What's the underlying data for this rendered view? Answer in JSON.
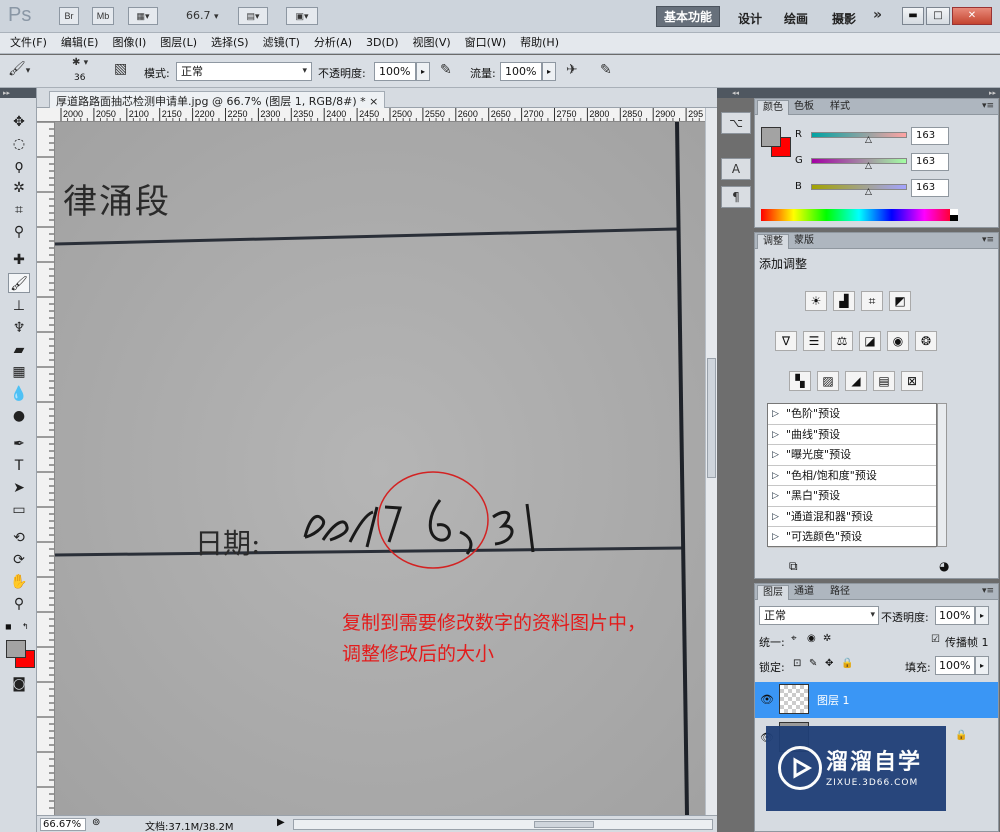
{
  "app": {
    "logo_text": "Ps",
    "bridge_label": "Br",
    "minibridge_label": "Mb",
    "zoom": "66.7"
  },
  "workspaces": {
    "essentials": "基本功能",
    "design": "设计",
    "painting": "绘画",
    "photography": "摄影",
    "more": "»"
  },
  "menu": [
    "文件(F)",
    "编辑(E)",
    "图像(I)",
    "图层(L)",
    "选择(S)",
    "滤镜(T)",
    "分析(A)",
    "3D(D)",
    "视图(V)",
    "窗口(W)",
    "帮助(H)"
  ],
  "options": {
    "brush_size": "36",
    "mode_label": "模式:",
    "mode_value": "正常",
    "opacity_label": "不透明度:",
    "opacity_value": "100%",
    "flow_label": "流量:",
    "flow_value": "100%"
  },
  "document": {
    "tab_title": "厚道路路面抽芯检测申请单.jpg @ 66.7% (图层 1, RGB/8#) * ×",
    "ruler_ticks": [
      "2000",
      "2050",
      "2100",
      "2150",
      "2200",
      "2250",
      "2300",
      "2350",
      "2400",
      "2450",
      "2500",
      "2550",
      "2600",
      "2650",
      "2700",
      "2750",
      "2800",
      "2850",
      "2900",
      "295"
    ],
    "text_top": "律涌段",
    "date_label": "日期:",
    "date_value": "2017.6.31",
    "annotation_line1": "复制到需要修改数字的资料图片中，",
    "annotation_line2": "调整修改后的大小",
    "status_zoom": "66.67%",
    "status_doc": "文档:37.1M/38.2M"
  },
  "color_panel": {
    "tabs": [
      "颜色",
      "色板",
      "样式"
    ],
    "r_label": "R",
    "g_label": "G",
    "b_label": "B",
    "r_value": "163",
    "g_value": "163",
    "b_value": "163",
    "fg_color": "#a3a3a3",
    "bg_color": "#ff0000"
  },
  "adjust_panel": {
    "tabs": [
      "调整",
      "蒙版"
    ],
    "title": "添加调整",
    "presets": [
      "\"色阶\"预设",
      "\"曲线\"预设",
      "\"曝光度\"预设",
      "\"色相/饱和度\"预设",
      "\"黑白\"预设",
      "\"通道混和器\"预设",
      "\"可选颜色\"预设"
    ]
  },
  "layers_panel": {
    "tabs": [
      "图层",
      "通道",
      "路径"
    ],
    "blend_mode": "正常",
    "opacity_label": "不透明度:",
    "opacity_value": "100%",
    "unify_label": "统一:",
    "propagate_label": "传播帧 1",
    "lock_label": "锁定:",
    "fill_label": "填充:",
    "fill_value": "100%",
    "layer1_name": "图层 1"
  },
  "watermark": {
    "title": "溜溜自学",
    "subtitle": "ZIXUE.3D66.COM"
  }
}
